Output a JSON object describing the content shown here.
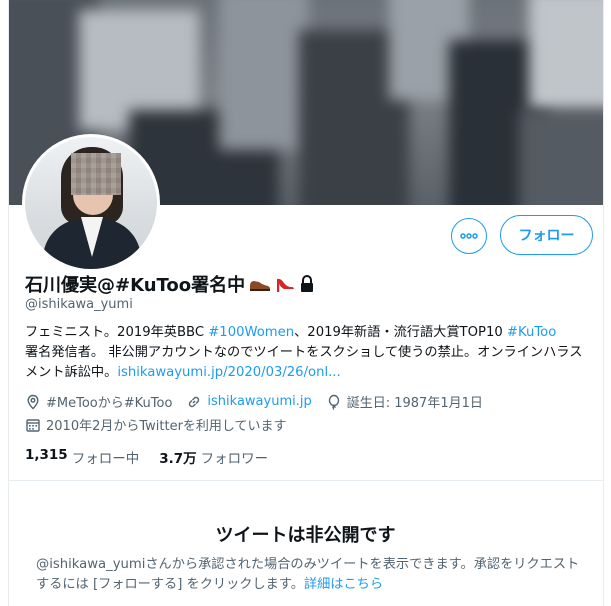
{
  "profile": {
    "name": "石川優実@#KuToo署名中",
    "handle": "@ishikawa_yumi",
    "bio": {
      "t1": "フェミニスト。2019年英BBC ",
      "h1": "#100Women",
      "t2": "、2019年新語・流行語大賞TOP10 ",
      "h2": "#KuToo",
      "t3": "署名発信者。 非公開アカウントなのでツイートをスクショして使うの禁止。オンラインハラスメント訴訟中。",
      "link": "ishikawayumi.jp/2020/03/26/onl..."
    },
    "location": "#MeTooから#KuToo",
    "website": "ishikawayumi.jp",
    "birthday": "誕生日: 1987年1月1日",
    "joined": "2010年2月からTwitterを利用しています",
    "following_count": "1,315",
    "following_label": "フォロー中",
    "followers_count": "3.7万",
    "followers_label": "フォロワー"
  },
  "actions": {
    "follow_label": "フォロー"
  },
  "private": {
    "title": "ツイートは非公開です",
    "message": "@ishikawa_yumiさんから承認された場合のみツイートを表示できます。承認をリクエストするには [フォローする] をクリックします。",
    "link": "詳細はこちら"
  },
  "icons": {
    "name_emojis": [
      "shoe-icon",
      "high-heel-icon",
      "lock-icon"
    ],
    "more": "more-options-icon",
    "location": "location-pin-icon",
    "website": "link-icon",
    "birthday": "balloon-icon",
    "joined": "calendar-icon"
  },
  "colors": {
    "accent": "#1d9bf0",
    "text": "#0f1419",
    "secondary": "#536471"
  }
}
